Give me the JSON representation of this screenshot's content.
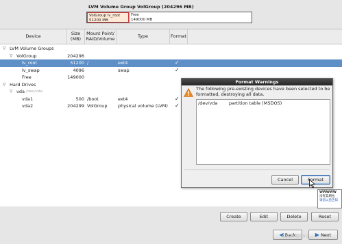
{
  "vg_summary": {
    "title": "LVM Volume Group VolGroup (204296 MB)",
    "segments": [
      {
        "line1": "VolGroup lv_root",
        "line2": "51200 MB"
      },
      {
        "line1": "Free",
        "line2": "149000 MB"
      }
    ]
  },
  "table": {
    "headers": {
      "device": "Device",
      "size": "Size\n(MB)",
      "mount": "Mount Point/\nRAID/Volume",
      "type": "Type",
      "format": "Format"
    },
    "rows": [
      {
        "tri": "▽",
        "device": "LVM Volume Groups",
        "size": "",
        "mount": "",
        "type": "",
        "format": ""
      },
      {
        "tri": "▽",
        "device": "VolGroup",
        "size": "204296",
        "mount": "",
        "type": "",
        "format": ""
      },
      {
        "tri": "",
        "device": "lv_root",
        "size": "51200",
        "mount": "/",
        "type": "ext4",
        "format": "✓"
      },
      {
        "tri": "",
        "device": "lv_swap",
        "size": "4096",
        "mount": "",
        "type": "swap",
        "format": "✓"
      },
      {
        "tri": "",
        "device": "Free",
        "size": "149000",
        "mount": "",
        "type": "",
        "format": ""
      },
      {
        "tri": "▽",
        "device": "Hard Drives",
        "size": "",
        "mount": "",
        "type": "",
        "format": ""
      },
      {
        "tri": "▽",
        "device": "vda",
        "device_note": "/dev/vda",
        "size": "",
        "mount": "",
        "type": "",
        "format": ""
      },
      {
        "tri": "",
        "device": "vda1",
        "size": "500",
        "mount": "/boot",
        "type": "ext4",
        "format": "✓"
      },
      {
        "tri": "",
        "device": "vda2",
        "size": "204299",
        "mount": "VolGroup",
        "type": "physical volume (LVM)",
        "format": "✓"
      }
    ]
  },
  "dialog": {
    "title": "Format Warnings",
    "message": "The following pre-existing devices have been selected to be formatted, destroying all data.",
    "items": [
      {
        "device": "/dev/vda",
        "desc": "partition table (MSDOS)"
      }
    ],
    "cancel_label": "Cancel",
    "format_label": "Format"
  },
  "tooltip": {
    "line1": "WWWWW",
    "line2": "没有又刷拉",
    "line3": "请您以后告知"
  },
  "buttons": {
    "create": "Create",
    "edit": "Edit",
    "delete": "Delete",
    "reset": "Reset",
    "back": "Back",
    "next": "Next"
  },
  "watermark": "CSDN @Red_..."
}
